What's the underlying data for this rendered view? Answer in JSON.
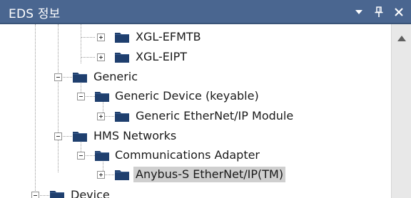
{
  "window": {
    "title": "EDS 정보"
  },
  "titlebar_buttons": [
    {
      "name": "dropdown-icon"
    },
    {
      "name": "pin-icon"
    },
    {
      "name": "close-icon"
    }
  ],
  "tree": {
    "nodes": [
      {
        "label": "XGL-EFMTB",
        "expander": "plus",
        "selected": false
      },
      {
        "label": "XGL-EIPT",
        "expander": "plus",
        "selected": false
      },
      {
        "label": "Generic",
        "expander": "minus",
        "selected": false
      },
      {
        "label": "Generic Device (keyable)",
        "expander": "minus",
        "selected": false
      },
      {
        "label": "Generic EtherNet/IP Module",
        "expander": "plus",
        "selected": false
      },
      {
        "label": "HMS Networks",
        "expander": "minus",
        "selected": false
      },
      {
        "label": "Communications Adapter",
        "expander": "minus",
        "selected": false
      },
      {
        "label": "Anybus-S EtherNet/IP(TM)",
        "expander": "plus",
        "selected": true
      },
      {
        "label": "Device",
        "expander": "minus",
        "selected": false
      }
    ]
  },
  "colors": {
    "titlebar": "#4a6690",
    "folder": "#1f3f6e",
    "selection": "#cfcfcf"
  }
}
